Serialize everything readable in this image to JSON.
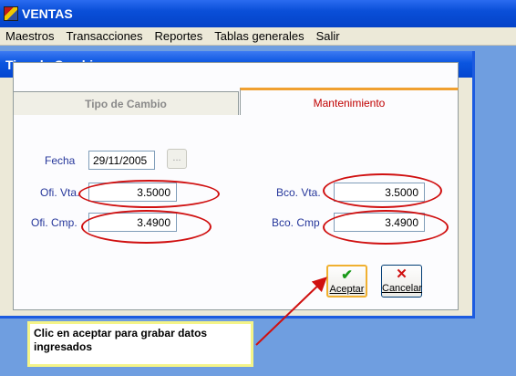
{
  "app": {
    "title": "VENTAS"
  },
  "menu": [
    "Maestros",
    "Transacciones",
    "Reportes",
    "Tablas generales",
    "Salir"
  ],
  "dialog": {
    "title": "Tipo de Cambio",
    "tabs": [
      {
        "label": "Tipo de Cambio",
        "active": false
      },
      {
        "label": "Mantenimiento",
        "active": true
      }
    ],
    "fields": {
      "fecha": {
        "label": "Fecha",
        "value": "29/11/2005",
        "button": "..."
      },
      "ofi_vta": {
        "label": "Ofi. Vta.",
        "value": "3.5000"
      },
      "ofi_cmp": {
        "label": "Ofi. Cmp.",
        "value": "3.4900"
      },
      "bco_vta": {
        "label": "Bco. Vta.",
        "value": "3.5000"
      },
      "bco_cmp": {
        "label": "Bco. Cmp",
        "value": "3.4900"
      }
    },
    "buttons": {
      "accept": {
        "label": "Aceptar",
        "icon": "checkmark-icon"
      },
      "cancel": {
        "label": "Cancelar",
        "icon": "x-icon"
      }
    }
  },
  "annotation": {
    "text": "Clic en aceptar para grabar datos ingresados"
  },
  "colors": {
    "titlebar": "#0a55e0",
    "label": "#26379b",
    "highlight": "#d01010",
    "tab_accent": "#f0a030"
  }
}
